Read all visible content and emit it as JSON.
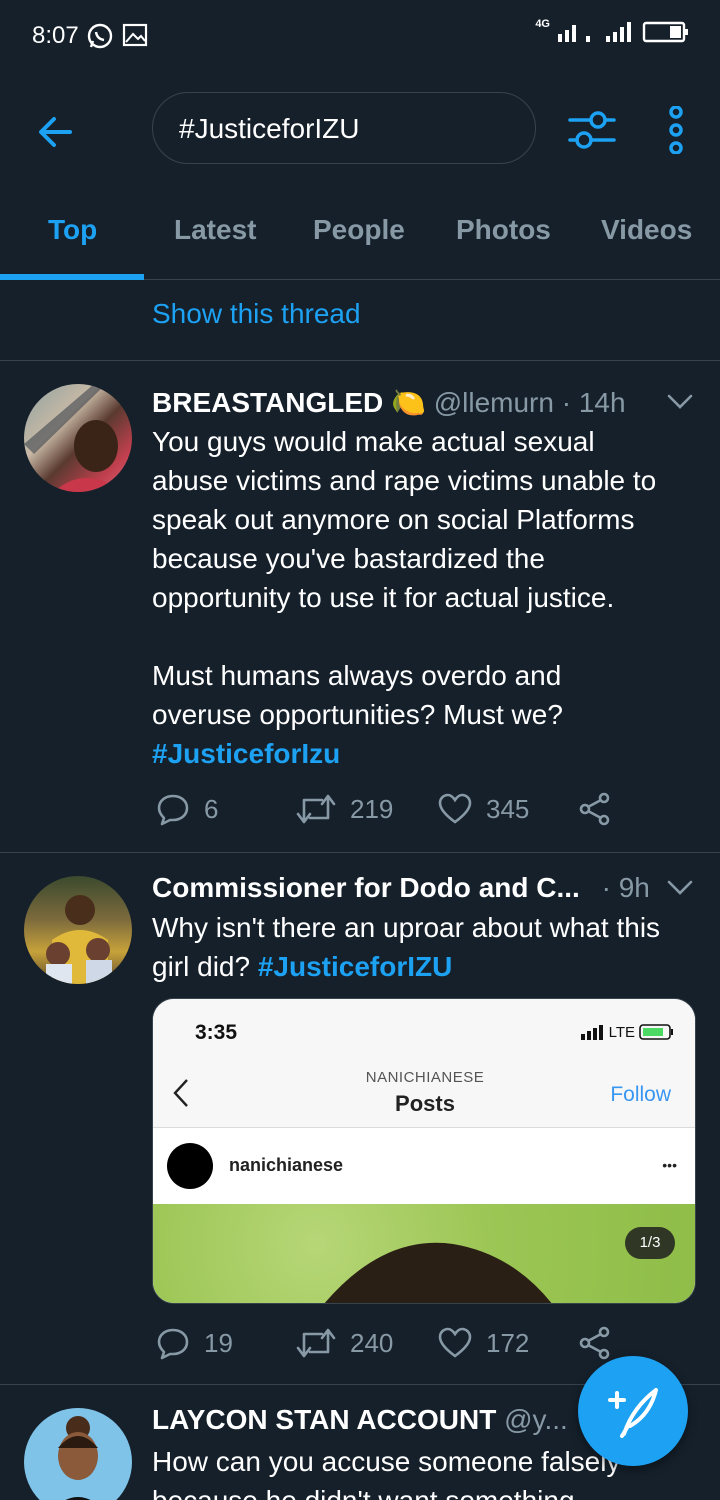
{
  "status": {
    "time": "8:07",
    "network": "4G"
  },
  "search": {
    "query": "#JusticeforIZU"
  },
  "icons": {
    "back": "back-arrow-icon",
    "filter": "filter-sliders-icon",
    "more": "more-vertical-icon",
    "compose": "compose-tweet-icon"
  },
  "tabs": [
    "Top",
    "Latest",
    "People",
    "Photos",
    "Videos"
  ],
  "show_thread": "Show this thread",
  "tweets": [
    {
      "name": "BREASTANGLED",
      "emoji": "🍋",
      "handle": "@llemurn",
      "time": "· 14h",
      "body_lines": [
        "You guys would make actual sexual",
        "abuse victims and rape victims unable to",
        "speak out anymore on social Platforms",
        "because you've bastardized the",
        "opportunity to use it for actual justice.",
        "",
        "Must humans always overdo and",
        "overuse opportunities? Must we?"
      ],
      "hashtag": "#JusticeforIzu",
      "replies": "6",
      "retweets": "219",
      "likes": "345"
    },
    {
      "name": "Commissioner for Dodo and C...",
      "handle": "",
      "time": "· 9h",
      "body_lines": [
        "Why isn't there an uproar about what this"
      ],
      "body_tail": "girl did?",
      "hashtag": "#JusticeforIZU",
      "replies": "19",
      "retweets": "240",
      "likes": "172",
      "media": {
        "time": "3:35",
        "network": "LTE",
        "account_caps": "NANICHIANESE",
        "title": "Posts",
        "follow": "Follow",
        "username": "nanichianese",
        "more": "•••",
        "counter": "1/3"
      }
    },
    {
      "name": "LAYCON STAN ACCOUNT",
      "handle": "@y...",
      "body_lines": [
        "How can you accuse someone falsely",
        "because he didn't want something"
      ]
    }
  ],
  "colors": {
    "accent": "#1da1f2",
    "background": "#15202b",
    "muted": "#8899a6",
    "divider": "#38444d"
  }
}
